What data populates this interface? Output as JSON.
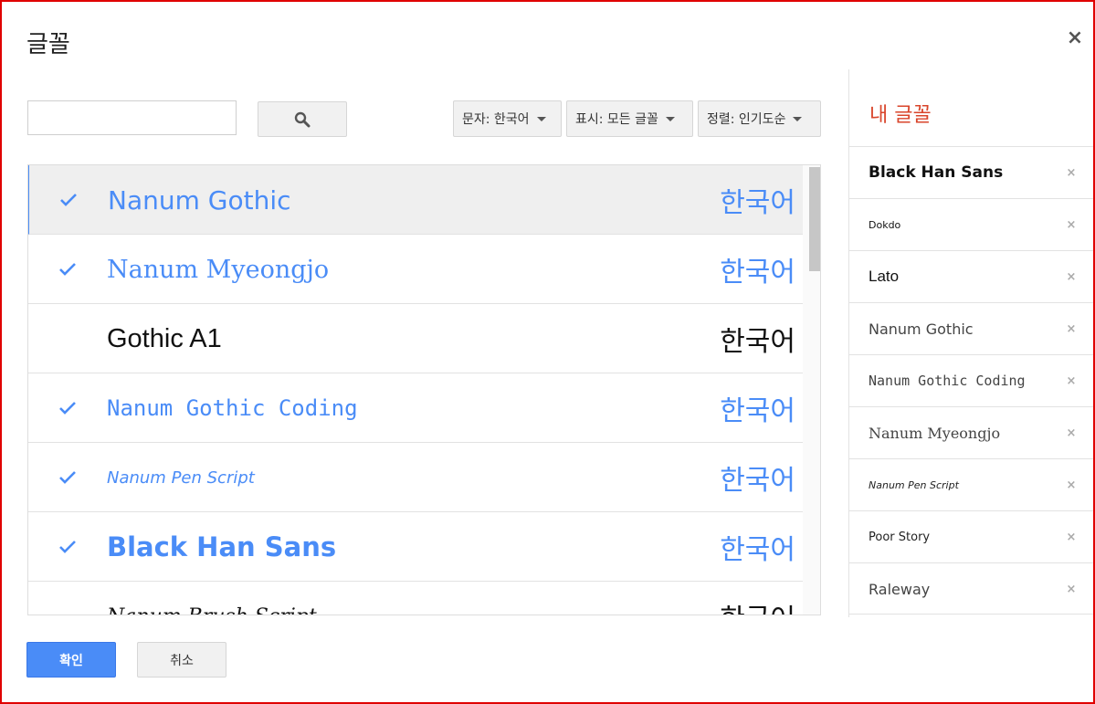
{
  "dialog": {
    "title": "글꼴",
    "close_symbol": "×"
  },
  "search": {
    "value": "",
    "placeholder": "",
    "icon": "search-icon"
  },
  "filters": [
    {
      "label": "문자: 한국어"
    },
    {
      "label": "표시: 모든 글꼴"
    },
    {
      "label": "정렬: 인기도순"
    }
  ],
  "font_list": [
    {
      "name": "Nanum Gothic",
      "sample": "한국어",
      "checked": true,
      "selected": true
    },
    {
      "name": "Nanum Myeongjo",
      "sample": "한국어",
      "checked": true,
      "selected": false
    },
    {
      "name": "Gothic A1",
      "sample": "한국어",
      "checked": false,
      "selected": false
    },
    {
      "name": "Nanum Gothic Coding",
      "sample": "한국어",
      "checked": true,
      "selected": false
    },
    {
      "name": "Nanum Pen Script",
      "sample": "한국어",
      "checked": true,
      "selected": false
    },
    {
      "name": "Black Han Sans",
      "sample": "한국어",
      "checked": true,
      "selected": false
    },
    {
      "name": "Nanum Brush Script",
      "sample": "한국어",
      "checked": false,
      "selected": false
    }
  ],
  "my_fonts": {
    "title": "내 글꼴",
    "items": [
      {
        "name": "Black Han Sans"
      },
      {
        "name": "Dokdo"
      },
      {
        "name": "Lato"
      },
      {
        "name": "Nanum Gothic"
      },
      {
        "name": "Nanum Gothic Coding"
      },
      {
        "name": "Nanum Myeongjo"
      },
      {
        "name": "Nanum Pen Script"
      },
      {
        "name": "Poor Story"
      },
      {
        "name": "Raleway"
      }
    ],
    "remove_symbol": "×"
  },
  "buttons": {
    "ok": "확인",
    "cancel": "취소"
  },
  "colors": {
    "accent": "#4a8cf7",
    "title_red": "#d9452b",
    "frame_border": "#e00000"
  }
}
